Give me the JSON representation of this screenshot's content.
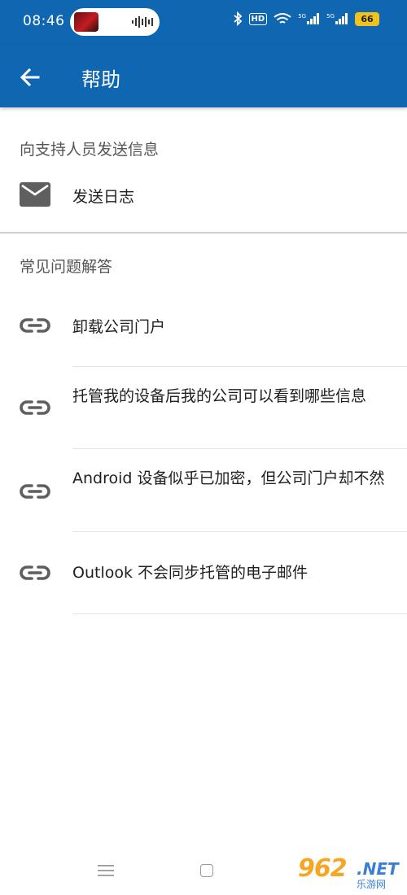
{
  "status_bar": {
    "time": "08:46",
    "hd": "HD",
    "sig1": "5G",
    "sig2": "5G",
    "battery": "66"
  },
  "app_bar": {
    "title": "帮助",
    "color": "#0f67b2"
  },
  "support": {
    "header": "向支持人员发送信息",
    "send_log_label": "发送日志",
    "icon": "mail-icon"
  },
  "faq": {
    "header": "常见问题解答",
    "items": [
      {
        "label": "卸载公司门户",
        "icon": "link-icon"
      },
      {
        "label": "托管我的设备后我的公司可以看到哪些信息",
        "icon": "link-icon"
      },
      {
        "label": "Android 设备似乎已加密，但公司门户却不然",
        "icon": "link-icon"
      },
      {
        "label": "Outlook 不会同步托管的电子邮件",
        "icon": "link-icon"
      }
    ]
  },
  "watermark": {
    "brand": "962",
    "net": ".NET",
    "sub": "乐游网"
  }
}
